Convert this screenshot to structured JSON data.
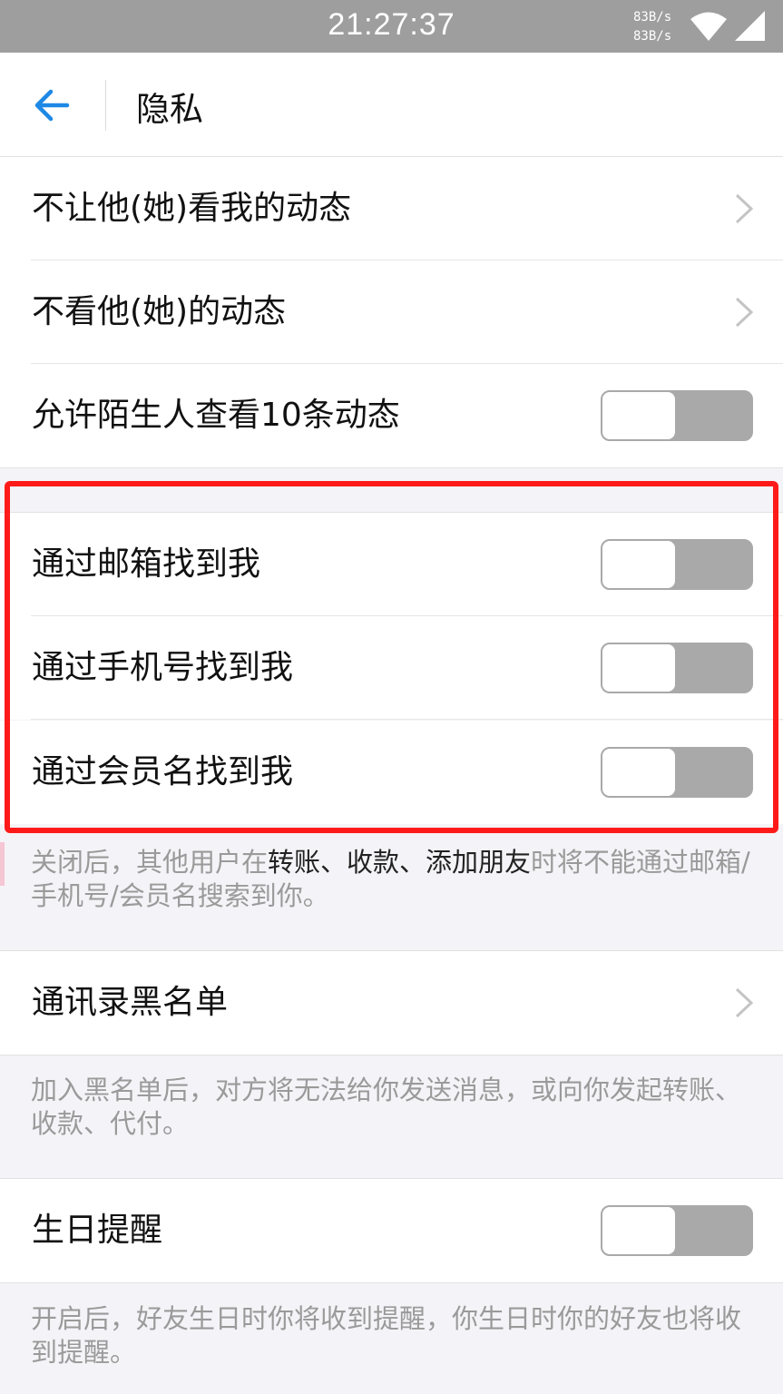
{
  "status_bar": {
    "time": "21:27:37",
    "net_up": "83B/s",
    "net_down": "83B/s",
    "wifi_icon": "wifi-icon",
    "signal_icon": "signal-icon"
  },
  "header": {
    "back_icon": "back-arrow-icon",
    "title": "隐私"
  },
  "settings": {
    "hide_my_moments": "不让他(她)看我的动态",
    "hide_their_moments": "不看他(她)的动态",
    "allow_strangers": {
      "label": "允许陌生人查看10条动态",
      "enabled": false
    },
    "find_by_email": {
      "label": "通过邮箱找到我",
      "enabled": false
    },
    "find_by_phone": {
      "label": "通过手机号找到我",
      "enabled": false
    },
    "find_by_member": {
      "label": "通过会员名找到我",
      "enabled": false
    },
    "find_note": {
      "part1": "关闭后，其他用户在",
      "part2": "转账、收款、添加朋友",
      "part3": "时将不能通过邮箱/手机号/会员名搜索到你。"
    },
    "blacklist": "通讯录黑名单",
    "blacklist_note": "加入黑名单后，对方将无法给你发送消息，或向你发起转账、收款、代付。",
    "birthday": {
      "label": "生日提醒",
      "enabled": false
    },
    "birthday_note": "开启后，好友生日时你将收到提醒，你生日时你的好友也将收到提醒。"
  },
  "colors": {
    "highlight_border": "#ff1a1a",
    "back_arrow": "#1e88e5",
    "toggle_off": "#a9a9a9"
  }
}
